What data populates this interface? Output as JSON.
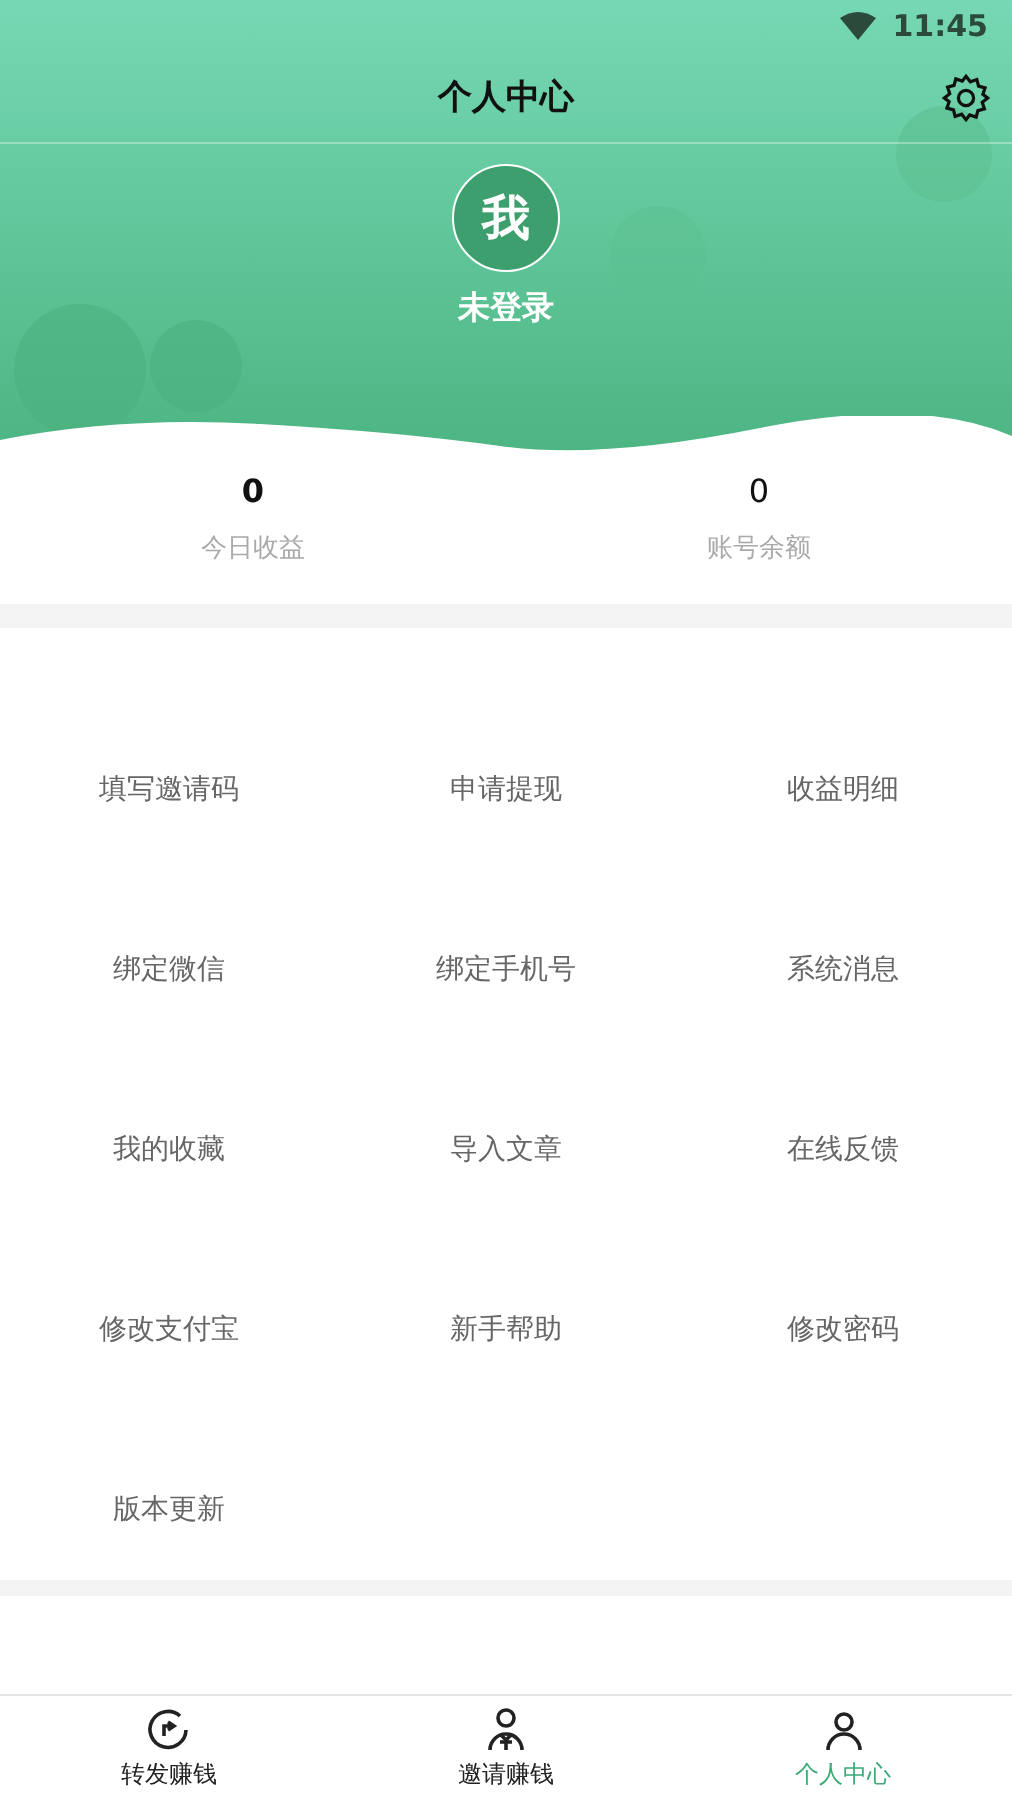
{
  "status_bar": {
    "time": "11:45"
  },
  "header": {
    "title": "个人中心",
    "avatar": "我",
    "login_status": "未登录"
  },
  "stats": [
    {
      "value": "0",
      "label": "今日收益"
    },
    {
      "value": "0",
      "label": "账号余额"
    }
  ],
  "menu": [
    "填写邀请码",
    "申请提现",
    "收益明细",
    "绑定微信",
    "绑定手机号",
    "系统消息",
    "我的收藏",
    "导入文章",
    "在线反馈",
    "修改支付宝",
    "新手帮助",
    "修改密码",
    "版本更新"
  ],
  "tabs": [
    {
      "label": "转发赚钱",
      "kind": "share",
      "selected": false
    },
    {
      "label": "邀请赚钱",
      "kind": "invite",
      "selected": false
    },
    {
      "label": "个人中心",
      "kind": "profile",
      "selected": true
    }
  ]
}
